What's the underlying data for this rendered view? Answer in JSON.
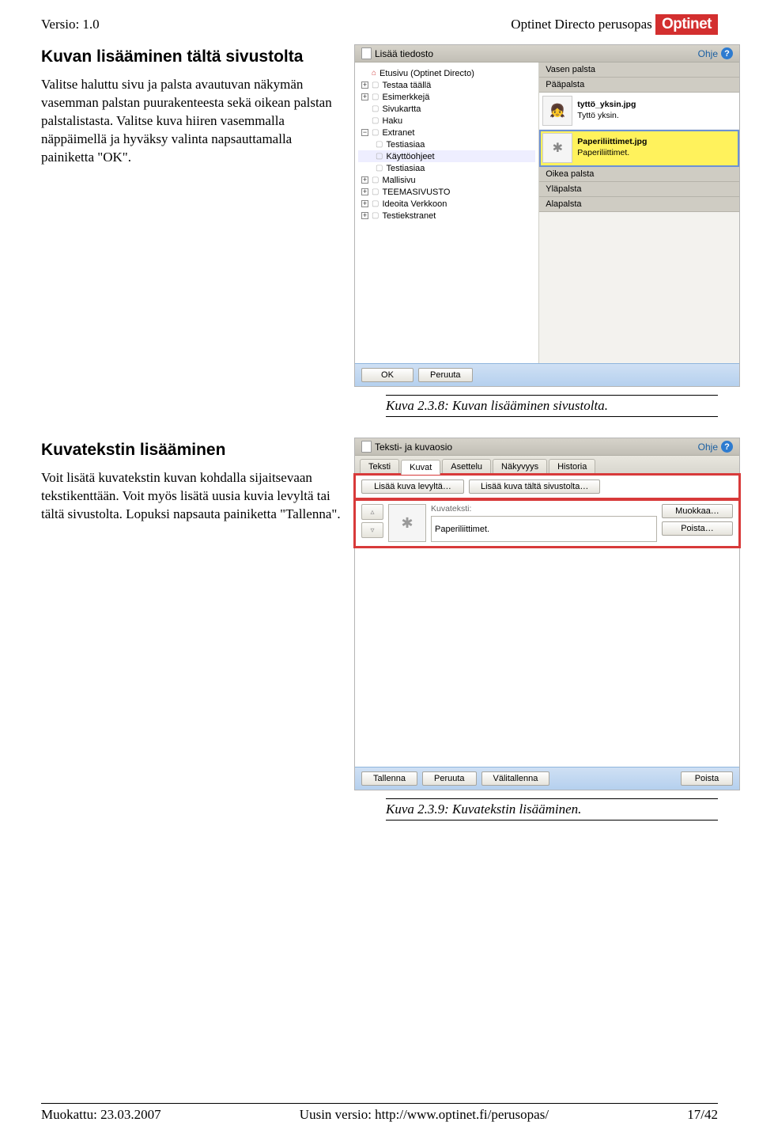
{
  "header": {
    "version": "Versio: 1.0",
    "doc_title": "Optinet Directo perusopas",
    "logo": "Optinet"
  },
  "section1": {
    "title": "Kuvan lisääminen tältä sivustolta",
    "body": "Valitse haluttu sivu ja palsta avautuvan näkymän vasemman palstan puurakenteesta sekä oikean palstan palstalistasta. Valitse kuva hiiren vasemmalla näppäimellä ja hyväksy valinta napsauttamalla painiketta \"OK\"."
  },
  "caption1": "Kuva 2.3.8: Kuvan lisääminen sivustolta.",
  "section2": {
    "title": "Kuvatekstin lisääminen",
    "body": "Voit lisätä kuvatekstin kuvan kohdalla sijaitsevaan tekstikenttään. Voit myös lisätä uusia kuvia levyltä tai tältä sivustolta. Lopuksi napsauta painiketta \"Tallenna\"."
  },
  "caption2": "Kuva 2.3.9: Kuvatekstin lisääminen.",
  "app1": {
    "title": "Lisää tiedosto",
    "help": "Ohje",
    "tree": [
      {
        "exp": "",
        "icon": "home",
        "label": "Etusivu (Optinet Directo)",
        "indent": 0
      },
      {
        "exp": "+",
        "icon": "page",
        "label": "Testaa täällä",
        "indent": 0
      },
      {
        "exp": "+",
        "icon": "page",
        "label": "Esimerkkejä",
        "indent": 0
      },
      {
        "exp": "",
        "icon": "page",
        "label": "Sivukartta",
        "indent": 0
      },
      {
        "exp": "",
        "icon": "page",
        "label": "Haku",
        "indent": 0
      },
      {
        "exp": "-",
        "icon": "page",
        "label": "Extranet",
        "indent": 0
      },
      {
        "exp": "",
        "icon": "page",
        "label": "Testiasiaa",
        "indent": 1
      },
      {
        "exp": "",
        "icon": "page",
        "label": "Käyttöohjeet",
        "indent": 1
      },
      {
        "exp": "",
        "icon": "page",
        "label": "Testiasiaa",
        "indent": 1
      },
      {
        "exp": "+",
        "icon": "page",
        "label": "Mallisivu",
        "indent": 0
      },
      {
        "exp": "+",
        "icon": "page",
        "label": "TEEMASIVUSTO",
        "indent": 0
      },
      {
        "exp": "+",
        "icon": "page",
        "label": "Ideoita Verkkoon",
        "indent": 0
      },
      {
        "exp": "+",
        "icon": "page",
        "label": "Testiekstranet",
        "indent": 0
      }
    ],
    "palstat": {
      "vasen": "Vasen palsta",
      "paa": "Pääpalsta",
      "file1": {
        "name": "tyttö_yksin.jpg",
        "desc": "Tyttö yksin."
      },
      "file2": {
        "name": "Paperiliittimet.jpg",
        "desc": "Paperiliittimet."
      },
      "oikea": "Oikea palsta",
      "yla": "Yläpalsta",
      "ala": "Alapalsta"
    },
    "footer": {
      "ok": "OK",
      "peruuta": "Peruuta"
    }
  },
  "app2": {
    "title": "Teksti- ja kuvaosio",
    "help": "Ohje",
    "tabs": [
      "Teksti",
      "Kuvat",
      "Asettelu",
      "Näkyvyys",
      "Historia"
    ],
    "btn_levy": "Lisää kuva levyltä…",
    "btn_sivusto": "Lisää kuva tältä sivustolta…",
    "kuvateksti_label": "Kuvateksti:",
    "kuvateksti_value": "Paperiliittimet.",
    "btn_muokkaa": "Muokkaa…",
    "btn_poista": "Poista…",
    "footer": {
      "tallenna": "Tallenna",
      "peruuta": "Peruuta",
      "valitallenna": "Välitallenna",
      "poista": "Poista"
    }
  },
  "footer": {
    "date": "Muokattu: 23.03.2007",
    "url": "Uusin versio: http://www.optinet.fi/perusopas/",
    "page": "17/42"
  }
}
